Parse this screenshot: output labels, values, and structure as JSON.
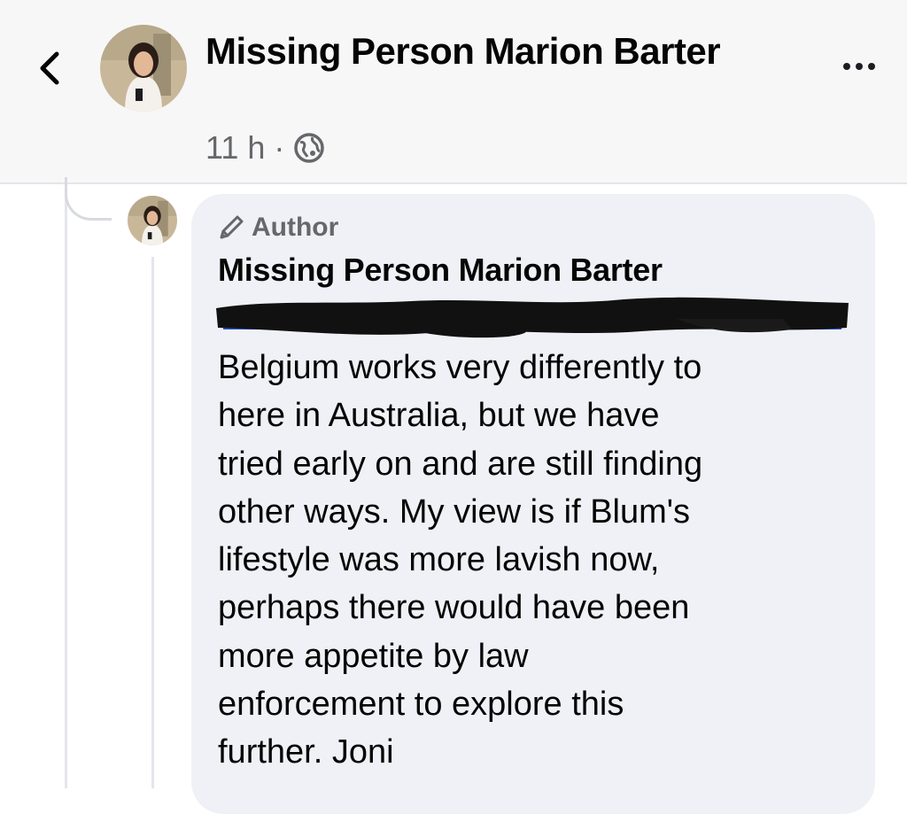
{
  "header": {
    "back_icon": "chevron-left-icon",
    "avatar_alt": "profile photo",
    "title": "Missing Person Marion Barter",
    "time": "11 h",
    "separator": "·",
    "audience_icon": "globe-icon",
    "more_icon": "more-horizontal-icon"
  },
  "comment": {
    "badge_icon": "pencil-icon",
    "badge_label": "Author",
    "author": "Missing Person Marion Barter",
    "redacted": true,
    "body": "Belgium works very differently to\nhere in Australia, but we have\ntried early on and are still finding\nother ways. My view is if Blum's\nlifestyle was more lavish now,\nperhaps there would have been\nmore appetite by law\nenforcement to explore this\nfurther.  Joni"
  },
  "colors": {
    "header_bg": "#f7f7f8",
    "bubble_bg": "#f0f1f6",
    "muted_text": "#65676b",
    "primary_text": "#050505"
  }
}
